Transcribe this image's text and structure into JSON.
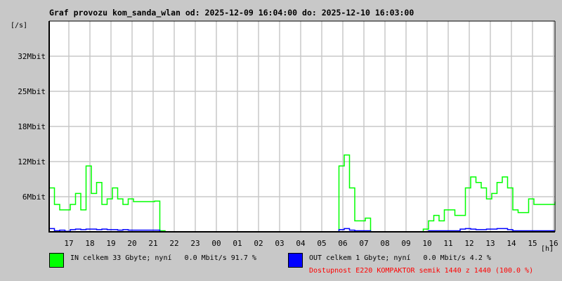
{
  "chart_data": {
    "type": "line",
    "title": "Graf provozu kom_sanda_wlan od: 2025-12-09 16:04:00 do: 2025-12-10 16:03:00",
    "ylabel": "[/s]",
    "xlabel": "[h]",
    "ylim": [
      0,
      38.4
    ],
    "y_ticks": [
      {
        "value": 6.4,
        "label": "6Mbit"
      },
      {
        "value": 12.8,
        "label": "12Mbit"
      },
      {
        "value": 19.2,
        "label": "18Mbit"
      },
      {
        "value": 25.6,
        "label": "25Mbit"
      },
      {
        "value": 32,
        "label": "32Mbit"
      }
    ],
    "x_start_minute": 4,
    "x_step_minutes": 15,
    "x_tick_labels": [
      "17",
      "18",
      "19",
      "20",
      "21",
      "22",
      "23",
      "00",
      "01",
      "02",
      "03",
      "04",
      "05",
      "06",
      "07",
      "08",
      "09",
      "10",
      "11",
      "12",
      "13",
      "14",
      "15",
      "16"
    ],
    "grid": true,
    "series": [
      {
        "name": "IN",
        "color": "#00ff00",
        "values": [
          8,
          5,
          4,
          4,
          5,
          7,
          4,
          12,
          7,
          9,
          5,
          6,
          8,
          6,
          5,
          6,
          5.5,
          5.5,
          5.5,
          5.5,
          5.6,
          0.2,
          0,
          0,
          0,
          0,
          0,
          0,
          0,
          0,
          0,
          0,
          0,
          0,
          0,
          0,
          0,
          0,
          0,
          0,
          0,
          0,
          0,
          0,
          0,
          0,
          0,
          0,
          0,
          0,
          0,
          0,
          0,
          0,
          0,
          12,
          14,
          8,
          2,
          2,
          2.5,
          0,
          0,
          0,
          0,
          0,
          0,
          0,
          0,
          0,
          0,
          0.5,
          2,
          3,
          2,
          4,
          4,
          3,
          3,
          8,
          10,
          9,
          8,
          6,
          7,
          9,
          10,
          8,
          4,
          3.5,
          3.5,
          6,
          5,
          5,
          5,
          5,
          5.5
        ]
      },
      {
        "name": "OUT",
        "color": "#0000ff",
        "values": [
          0.6,
          0.2,
          0.3,
          0.1,
          0.4,
          0.5,
          0.4,
          0.5,
          0.5,
          0.4,
          0.5,
          0.4,
          0.4,
          0.3,
          0.4,
          0.3,
          0.3,
          0.3,
          0.3,
          0.3,
          0.3,
          0,
          0,
          0,
          0,
          0,
          0,
          0,
          0,
          0,
          0,
          0,
          0,
          0,
          0,
          0,
          0,
          0,
          0,
          0,
          0,
          0,
          0,
          0,
          0,
          0,
          0,
          0,
          0,
          0,
          0,
          0,
          0,
          0,
          0,
          0.4,
          0.6,
          0.3,
          0.2,
          0.2,
          0.2,
          0,
          0,
          0,
          0,
          0,
          0,
          0,
          0,
          0,
          0,
          0,
          0.2,
          0.2,
          0.2,
          0.2,
          0.2,
          0.2,
          0.5,
          0.6,
          0.5,
          0.4,
          0.4,
          0.5,
          0.5,
          0.6,
          0.6,
          0.4,
          0.2,
          0.2,
          0.2,
          0.2,
          0.2,
          0.2,
          0.2,
          0.2,
          0.2
        ]
      }
    ]
  },
  "legend": {
    "in_text": "IN celkem 33 Gbyte; nyní   0.0 Mbit/s 91.7 %",
    "out_text": "OUT celkem 1 Gbyte; nyní   0.0 Mbit/s 4.2 %",
    "availability": "Dostupnost E220 KOMPAKTOR semik 1440 z 1440 (100.0 %)",
    "availability_color": "#ff0000"
  }
}
